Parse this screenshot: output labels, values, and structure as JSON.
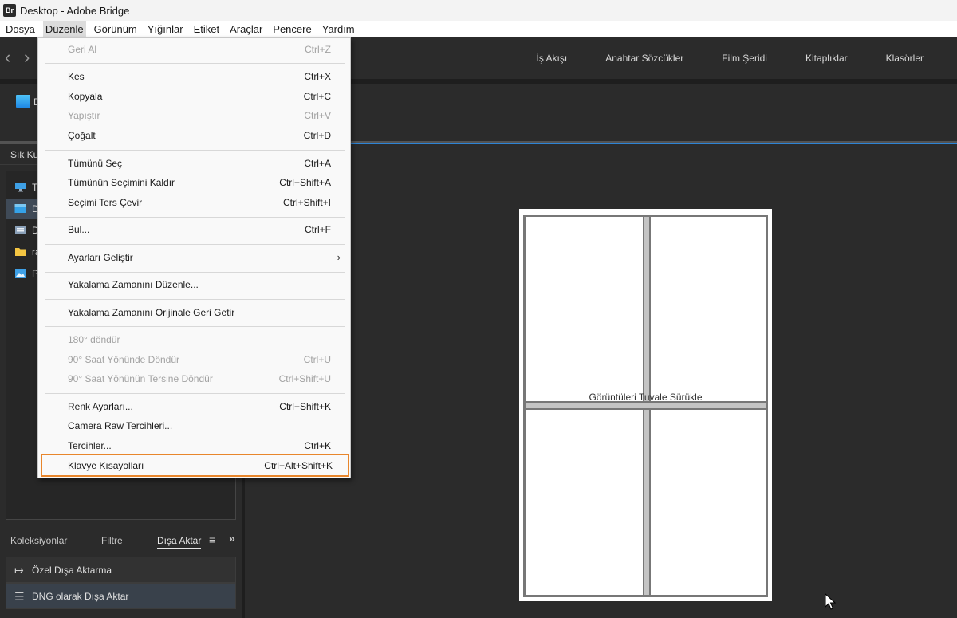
{
  "window": {
    "app_icon": "Br",
    "title": "Desktop - Adobe Bridge"
  },
  "menubar": [
    "Dosya",
    "Düzenle",
    "Görünüm",
    "Yığınlar",
    "Etiket",
    "Araçlar",
    "Pencere",
    "Yardım"
  ],
  "workspaces": [
    "İş Akışı",
    "Anahtar Sözcükler",
    "Film Şeridi",
    "Kitaplıklar",
    "Klasörler"
  ],
  "path": {
    "label": "D"
  },
  "favorites": {
    "tab": "Sık Ku",
    "items": [
      {
        "label": "T",
        "icon": "monitor-icon"
      },
      {
        "label": "D",
        "icon": "desktop-icon",
        "selected": true
      },
      {
        "label": "D",
        "icon": "documents-icon"
      },
      {
        "label": "ra",
        "icon": "folder-icon"
      },
      {
        "label": "P",
        "icon": "pictures-icon"
      }
    ]
  },
  "bottom_panel": {
    "tabs": [
      "Koleksiyonlar",
      "Filtre",
      "Dışa Aktar"
    ],
    "items": [
      {
        "label": "Özel Dışa Aktarma",
        "icon": "export-icon"
      },
      {
        "label": "DNG olarak Dışa Aktar",
        "icon": "list-icon"
      }
    ]
  },
  "canvas": {
    "hint": "Görüntüleri Tuvale Sürükle"
  },
  "edit_menu": {
    "undo": {
      "label": "Geri Al",
      "shortcut": "Ctrl+Z"
    },
    "cut": {
      "label": "Kes",
      "shortcut": "Ctrl+X"
    },
    "copy": {
      "label": "Kopyala",
      "shortcut": "Ctrl+C"
    },
    "paste": {
      "label": "Yapıştır",
      "shortcut": "Ctrl+V"
    },
    "duplicate": {
      "label": "Çoğalt",
      "shortcut": "Ctrl+D"
    },
    "select_all": {
      "label": "Tümünü Seç",
      "shortcut": "Ctrl+A"
    },
    "deselect_all": {
      "label": "Tümünün Seçimini Kaldır",
      "shortcut": "Ctrl+Shift+A"
    },
    "invert_selection": {
      "label": "Seçimi Ters Çevir",
      "shortcut": "Ctrl+Shift+I"
    },
    "find": {
      "label": "Bul...",
      "shortcut": "Ctrl+F"
    },
    "develop_settings": {
      "label": "Ayarları Geliştir"
    },
    "edit_capture_time": {
      "label": "Yakalama Zamanını Düzenle..."
    },
    "revert_capture_time": {
      "label": "Yakalama Zamanını Orijinale Geri Getir"
    },
    "rotate_180": {
      "label": "180° döndür"
    },
    "rotate_cw": {
      "label": "90° Saat Yönünde Döndür",
      "shortcut": "Ctrl+U"
    },
    "rotate_ccw": {
      "label": "90° Saat Yönünün Tersine Döndür",
      "shortcut": "Ctrl+Shift+U"
    },
    "color_settings": {
      "label": "Renk Ayarları...",
      "shortcut": "Ctrl+Shift+K"
    },
    "camera_raw_prefs": {
      "label": "Camera Raw Tercihleri..."
    },
    "preferences": {
      "label": "Tercihler...",
      "shortcut": "Ctrl+K"
    },
    "keyboard_shortcuts": {
      "label": "Klavye Kısayolları",
      "shortcut": "Ctrl+Alt+Shift+K"
    }
  },
  "colors": {
    "highlight_border": "#e8862c",
    "accent": "#2e84d6"
  }
}
